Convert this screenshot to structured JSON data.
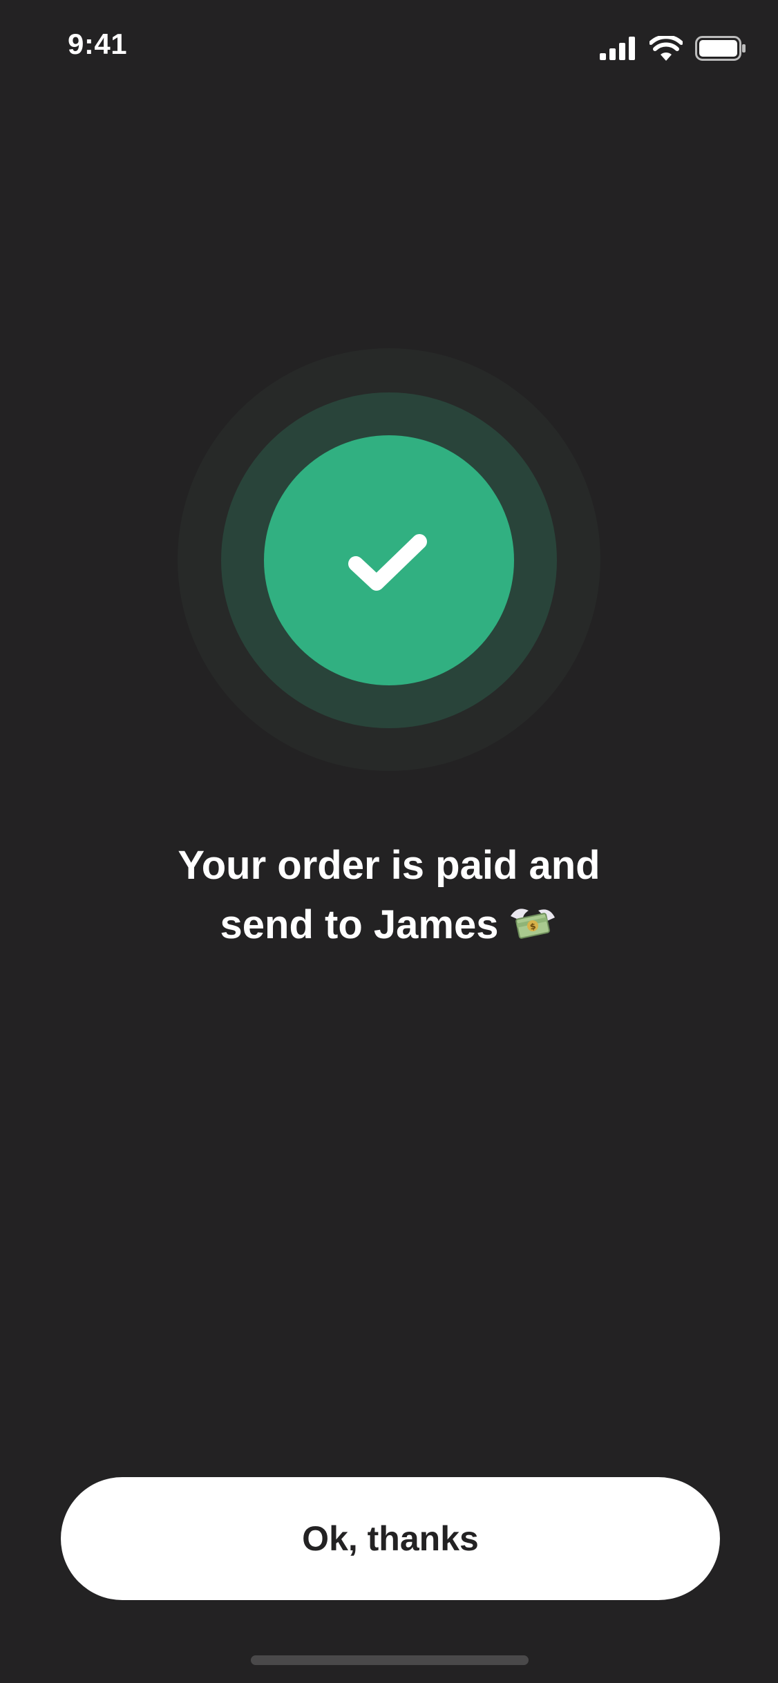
{
  "status_bar": {
    "time": "9:41",
    "icons": [
      "signal-icon",
      "wifi-icon",
      "battery-icon"
    ]
  },
  "success": {
    "icon": "checkmark-icon",
    "colors": {
      "outer_ring": "#272928",
      "middle_ring": "#29443a",
      "inner_circle": "#31b081"
    }
  },
  "message": {
    "line1": "Your order is paid and",
    "line2": "send to James",
    "emoji": "money-with-wings-icon"
  },
  "actions": {
    "ok_label": "Ok, thanks"
  },
  "theme": {
    "background": "#232223",
    "button_background": "#ffffff",
    "button_text": "#232223"
  }
}
